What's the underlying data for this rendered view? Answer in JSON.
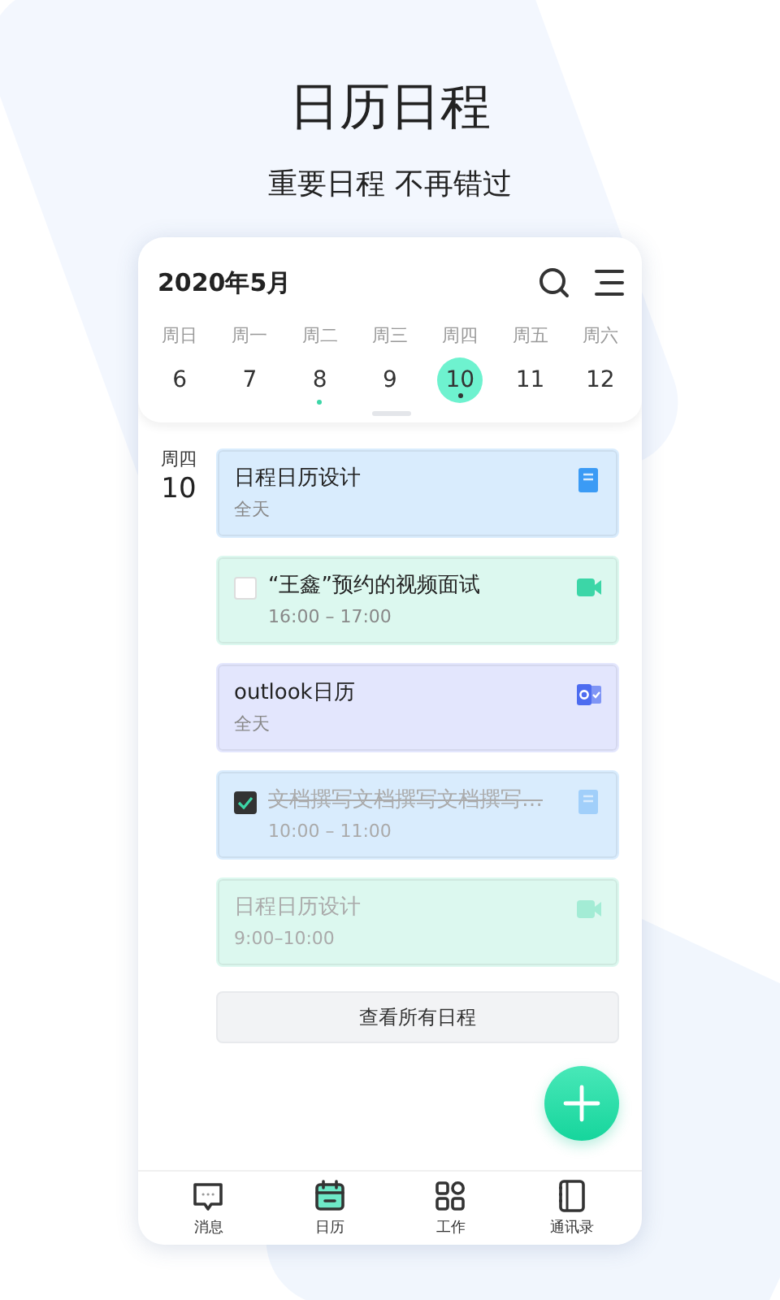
{
  "headline": {
    "title": "日历日程",
    "subtitle": "重要日程 不再错过"
  },
  "calendar": {
    "month": "2020年5月",
    "weekdays": [
      "周日",
      "周一",
      "周二",
      "周三",
      "周四",
      "周五",
      "周六"
    ],
    "days": [
      {
        "date": "6",
        "selected": false,
        "dot": false
      },
      {
        "date": "7",
        "selected": false,
        "dot": false
      },
      {
        "date": "8",
        "selected": false,
        "dot": true
      },
      {
        "date": "9",
        "selected": false,
        "dot": false
      },
      {
        "date": "10",
        "selected": true,
        "dot": true
      },
      {
        "date": "11",
        "selected": false,
        "dot": false
      },
      {
        "date": "12",
        "selected": false,
        "dot": false
      }
    ]
  },
  "agenda": {
    "weekday": "周四",
    "date": "10",
    "events": [
      {
        "title": "日程日历设计",
        "time": "全天",
        "kind": "note",
        "color": "#d9ecfd",
        "faded": false
      },
      {
        "title": "“王鑫”预约的视频面试",
        "time": "16:00 – 17:00",
        "kind": "meeting",
        "checked": false,
        "color": "#dcf8ef",
        "faded": false
      },
      {
        "title": "outlook日历",
        "time": "全天",
        "kind": "mail",
        "color": "#e3e6fd",
        "faded": false
      },
      {
        "title": "文档撰写文档撰写文档撰写…",
        "time": "10:00 – 11:00",
        "kind": "note",
        "checked": true,
        "color": "#d9ecfd",
        "faded": true
      },
      {
        "title": "日程日历设计",
        "time": "9:00–10:00",
        "kind": "meeting",
        "color": "#dcf8ef",
        "faded": true
      }
    ],
    "all_button": "查看所有日程"
  },
  "nav": [
    {
      "label": "消息",
      "kind": "messages",
      "selected": false
    },
    {
      "label": "日历",
      "kind": "calendar",
      "selected": true
    },
    {
      "label": "工作",
      "kind": "work",
      "selected": false
    },
    {
      "label": "通讯录",
      "kind": "contacts",
      "selected": false
    }
  ]
}
